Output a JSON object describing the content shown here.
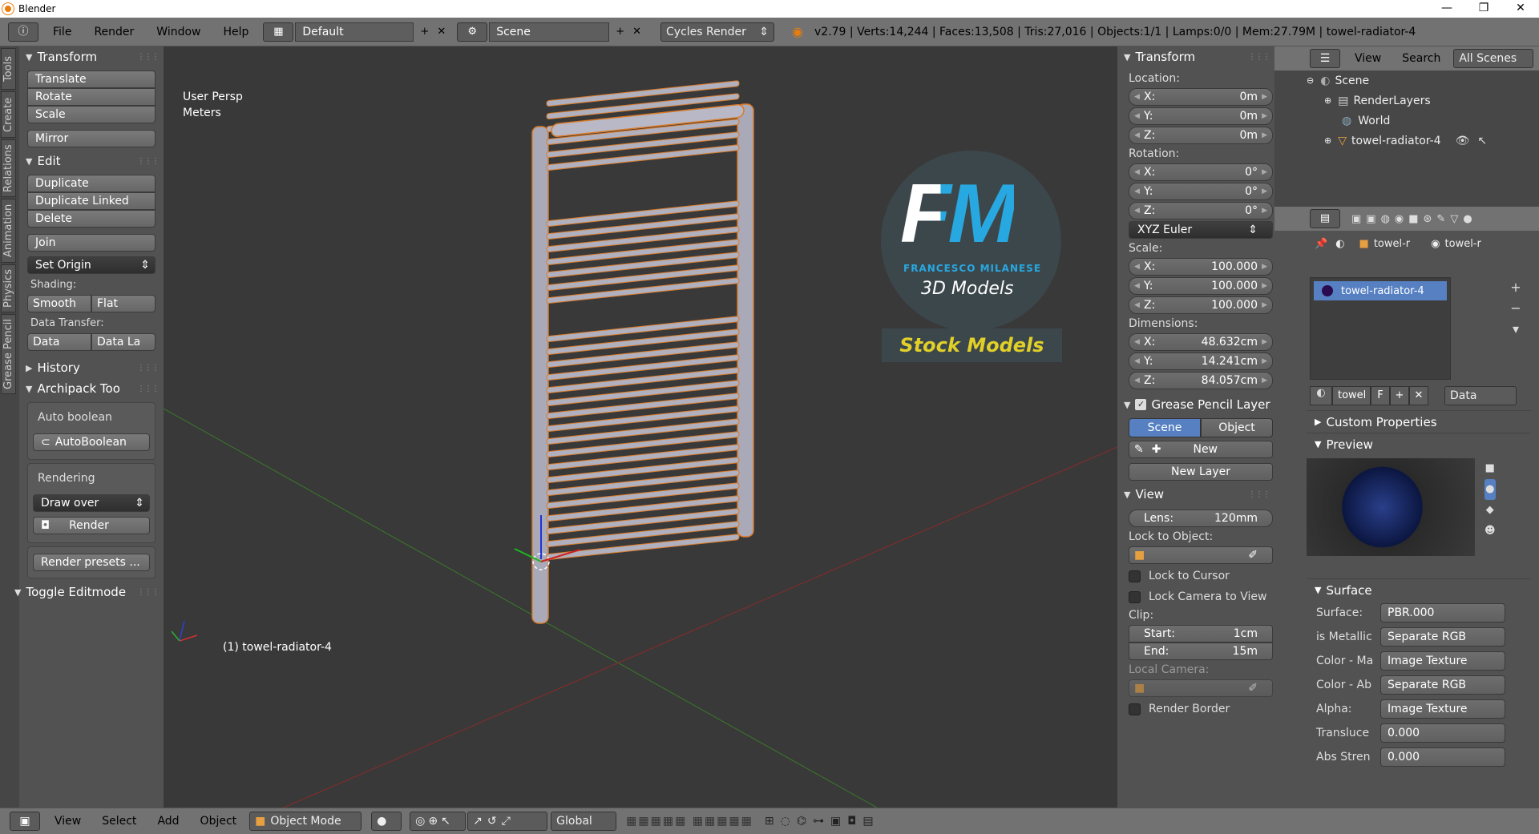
{
  "window": {
    "title": "Blender"
  },
  "topbar": {
    "menus": [
      "File",
      "Render",
      "Window",
      "Help"
    ],
    "screen_layout": "Default",
    "scene": "Scene",
    "render_engine": "Cycles Render",
    "stats": "v2.79 | Verts:14,244 | Faces:13,508 | Tris:27,016 | Objects:1/1 | Lamps:0/0 | Mem:27.79M | towel-radiator-4"
  },
  "left_tabs": [
    "Tools",
    "Create",
    "Relations",
    "Animation",
    "Physics",
    "Grease Pencil"
  ],
  "toolshelf": {
    "transform": {
      "header": "Transform",
      "buttons": [
        "Translate",
        "Rotate",
        "Scale",
        "Mirror"
      ]
    },
    "edit": {
      "header": "Edit",
      "buttons": [
        "Duplicate",
        "Duplicate Linked",
        "Delete",
        "Join"
      ],
      "set_origin": "Set Origin"
    },
    "shading": {
      "label": "Shading:",
      "smooth": "Smooth",
      "flat": "Flat"
    },
    "data_transfer": {
      "label": "Data Transfer:",
      "data": "Data",
      "data_la": "Data La"
    },
    "history": "History",
    "archipack": {
      "header": "Archipack Too",
      "auto_boolean_label": "Auto boolean",
      "auto_boolean_btn": "AutoBoolean",
      "rendering_label": "Rendering",
      "draw_over": "Draw over",
      "render_btn": "Render",
      "render_presets": "Render presets ..."
    },
    "toggle_editmode": "Toggle Editmode"
  },
  "viewport": {
    "view_name": "User Persp",
    "units": "Meters",
    "object_label": "(1) towel-radiator-4",
    "watermark": {
      "fm": "FM",
      "company": "FRANCESCO MILANESE",
      "models": "3D Models",
      "stock": "Stock Models"
    }
  },
  "npanel": {
    "transform_header": "Transform",
    "location_label": "Location:",
    "location": [
      {
        "k": "X:",
        "v": "0m"
      },
      {
        "k": "Y:",
        "v": "0m"
      },
      {
        "k": "Z:",
        "v": "0m"
      }
    ],
    "rotation_label": "Rotation:",
    "rotation": [
      {
        "k": "X:",
        "v": "0°"
      },
      {
        "k": "Y:",
        "v": "0°"
      },
      {
        "k": "Z:",
        "v": "0°"
      }
    ],
    "rotation_mode": "XYZ Euler",
    "scale_label": "Scale:",
    "scale": [
      {
        "k": "X:",
        "v": "100.000"
      },
      {
        "k": "Y:",
        "v": "100.000"
      },
      {
        "k": "Z:",
        "v": "100.000"
      }
    ],
    "dimensions_label": "Dimensions:",
    "dimensions": [
      {
        "k": "X:",
        "v": "48.632cm"
      },
      {
        "k": "Y:",
        "v": "14.241cm"
      },
      {
        "k": "Z:",
        "v": "84.057cm"
      }
    ],
    "grease_header": "Grease Pencil Layer",
    "gp_scene": "Scene",
    "gp_object": "Object",
    "gp_new": "New",
    "gp_new_layer": "New Layer",
    "view_header": "View",
    "lens_label": "Lens:",
    "lens_value": "120mm",
    "lock_to_object": "Lock to Object:",
    "lock_to_cursor": "Lock to Cursor",
    "lock_camera": "Lock Camera to View",
    "clip_label": "Clip:",
    "clip_start_label": "Start:",
    "clip_start": "1cm",
    "clip_end_label": "End:",
    "clip_end": "15m",
    "local_camera": "Local Camera:",
    "render_border": "Render Border"
  },
  "outliner": {
    "view": "View",
    "search": "Search",
    "scope": "All Scenes",
    "items": [
      "Scene",
      "RenderLayers",
      "World",
      "towel-radiator-4"
    ]
  },
  "properties": {
    "crumb1": "towel-r",
    "crumb2": "towel-r",
    "material_slot": "towel-radiator-4",
    "datablock_name": "towel",
    "datablock_f": "F",
    "link": "Data",
    "custom_props": "Custom Properties",
    "preview": "Preview",
    "surface_header": "Surface",
    "surface_rows": [
      {
        "label": "Surface:",
        "value": "PBR.000"
      },
      {
        "label": "is Metallic",
        "value": "Separate RGB"
      },
      {
        "label": "Color - Ma",
        "value": "Image Texture"
      },
      {
        "label": "Color - Ab",
        "value": "Separate RGB"
      },
      {
        "label": "Alpha:",
        "value": "Image Texture"
      },
      {
        "label": "Transluce",
        "value": "0.000"
      },
      {
        "label": "Abs Stren",
        "value": "0.000"
      }
    ]
  },
  "bottombar": {
    "menus": [
      "View",
      "Select",
      "Add",
      "Object"
    ],
    "mode": "Object Mode",
    "orientation": "Global"
  },
  "colors": {
    "selected_blue": "#5680c2",
    "viewport_bg": "#393939",
    "panel_bg": "#525252",
    "header_bg": "#727272"
  }
}
